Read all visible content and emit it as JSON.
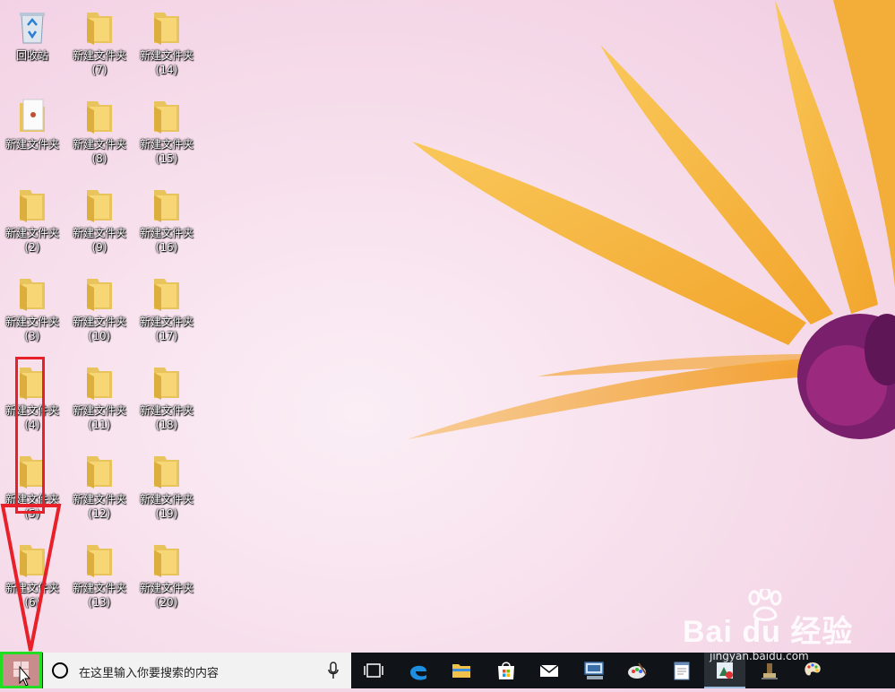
{
  "desktop": {
    "icons": [
      {
        "label": "回收站",
        "sub": "",
        "kind": "recycle-bin"
      },
      {
        "label": "新建文件夹",
        "sub": "(7)",
        "kind": "folder"
      },
      {
        "label": "新建文件夹",
        "sub": "(14)",
        "kind": "folder"
      },
      {
        "label": "新建文件夹",
        "sub": "",
        "kind": "document"
      },
      {
        "label": "新建文件夹",
        "sub": "(8)",
        "kind": "folder"
      },
      {
        "label": "新建文件夹",
        "sub": "(15)",
        "kind": "folder"
      },
      {
        "label": "新建文件夹",
        "sub": "(2)",
        "kind": "folder"
      },
      {
        "label": "新建文件夹",
        "sub": "(9)",
        "kind": "folder"
      },
      {
        "label": "新建文件夹",
        "sub": "(16)",
        "kind": "folder"
      },
      {
        "label": "新建文件夹",
        "sub": "(3)",
        "kind": "folder"
      },
      {
        "label": "新建文件夹",
        "sub": "(10)",
        "kind": "folder"
      },
      {
        "label": "新建文件夹",
        "sub": "(17)",
        "kind": "folder"
      },
      {
        "label": "新建文件夹",
        "sub": "(4)",
        "kind": "folder"
      },
      {
        "label": "新建文件夹",
        "sub": "(11)",
        "kind": "folder"
      },
      {
        "label": "新建文件夹",
        "sub": "(18)",
        "kind": "folder"
      },
      {
        "label": "新建文件夹",
        "sub": "(5)",
        "kind": "folder"
      },
      {
        "label": "新建文件夹",
        "sub": "(12)",
        "kind": "folder"
      },
      {
        "label": "新建文件夹",
        "sub": "(19)",
        "kind": "folder"
      },
      {
        "label": "新建文件夹",
        "sub": "(6)",
        "kind": "folder"
      },
      {
        "label": "新建文件夹",
        "sub": "(13)",
        "kind": "folder"
      },
      {
        "label": "新建文件夹",
        "sub": "(20)",
        "kind": "folder"
      }
    ]
  },
  "taskbar": {
    "search_placeholder": "在这里输入你要搜索的内容",
    "apps": [
      "task-view-icon",
      "edge-icon",
      "file-explorer-icon",
      "store-icon",
      "mail-icon",
      "remote-desktop-icon",
      "paint-icon",
      "notepad-icon",
      "screenshot-app-icon",
      "stamp-icon",
      "palette-icon"
    ]
  },
  "watermark": {
    "text": "Bai du 经验",
    "url": "jingyan.baidu.com"
  },
  "colors": {
    "annotation_red": "#e8202a",
    "annotation_green": "#22dd22",
    "taskbar_bg": "#101318"
  }
}
